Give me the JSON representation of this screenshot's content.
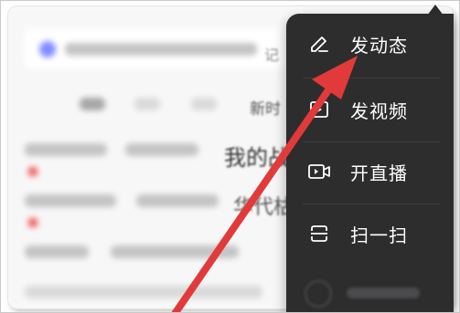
{
  "background": {
    "tab_hint": "新时",
    "line_1_hint": "我的战",
    "line_2_hint": "华代枯",
    "topbar_hint": "记"
  },
  "menu": {
    "items": [
      {
        "label": "发动态",
        "icon": "pencil-icon"
      },
      {
        "label": "发视频",
        "icon": "video-icon"
      },
      {
        "label": "开直播",
        "icon": "live-camera-icon"
      },
      {
        "label": "扫一扫",
        "icon": "scan-icon"
      }
    ]
  },
  "annotation": {
    "arrow_color": "#e23a3a",
    "points_to": "发动态"
  }
}
